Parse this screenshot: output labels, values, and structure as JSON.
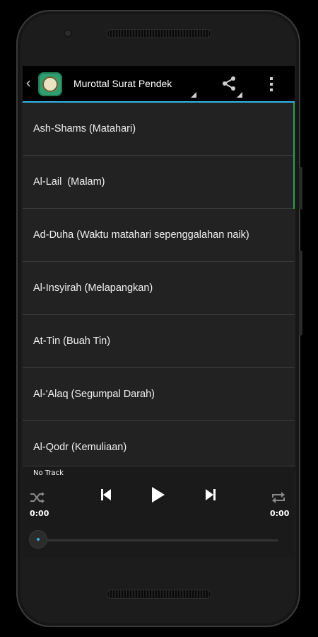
{
  "app": {
    "title": "Murottal Surat Pendek",
    "icons": {
      "up": "back-caret-icon",
      "app": "quran-app-icon",
      "share": "share-icon",
      "overflow": "overflow-menu-icon"
    },
    "accent_color": "#33b5e5"
  },
  "surahs": [
    {
      "label": "Ash-Shams (Matahari)"
    },
    {
      "label": "Al-Lail  (Malam)"
    },
    {
      "label": "Ad-Duha (Waktu matahari sepenggalahan naik)"
    },
    {
      "label": "Al-Insyirah (Melapangkan)"
    },
    {
      "label": "At-Tin (Buah Tin)"
    },
    {
      "label": "Al-'Alaq (Segumpal Darah)"
    },
    {
      "label": "Al-Qodr (Kemuliaan)"
    }
  ],
  "player": {
    "track": "No Track",
    "elapsed": "0:00",
    "duration": "0:00",
    "progress": 0,
    "icons": {
      "shuffle": "shuffle-icon",
      "previous": "skip-previous-icon",
      "play": "play-icon",
      "next": "skip-next-icon",
      "repeat": "repeat-icon"
    }
  }
}
